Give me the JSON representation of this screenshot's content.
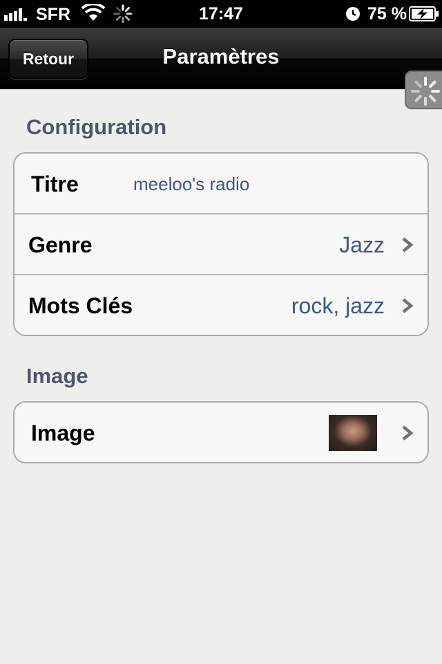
{
  "status_bar": {
    "carrier": "SFR",
    "time": "17:47",
    "battery_percent": "75 %"
  },
  "nav_bar": {
    "back_label": "Retour",
    "title": "Paramètres"
  },
  "sections": {
    "configuration": {
      "header": "Configuration",
      "title_row": {
        "label": "Titre",
        "value": "meeloo's radio"
      },
      "genre_row": {
        "label": "Genre",
        "value": "Jazz"
      },
      "keywords_row": {
        "label": "Mots Clés",
        "value": "rock, jazz"
      }
    },
    "image": {
      "header": "Image",
      "image_row": {
        "label": "Image"
      }
    }
  },
  "colors": {
    "value_text": "#3b5788",
    "section_header": "#4c566c",
    "background": "#eeeeec"
  }
}
